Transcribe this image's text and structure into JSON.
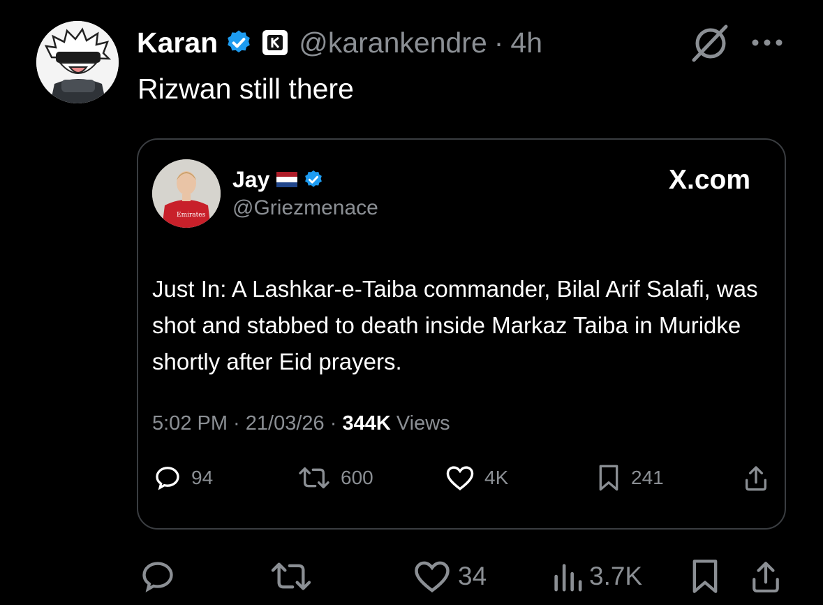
{
  "post": {
    "author_name": "Karan",
    "handle": "@karankendre",
    "separator": "·",
    "time": "4h",
    "text": "Rizwan still there"
  },
  "quoted": {
    "author_name": "Jay",
    "handle": "@Griezmenace",
    "source": "X.com",
    "text": "Just In: A Lashkar-e-Taiba commander, Bilal Arif Salafi, was shot and stabbed to death inside Markaz Taiba in Muridke shortly after Eid prayers.",
    "time": "5:02 PM",
    "date": "21/03/26",
    "views_count": "344K",
    "views_label": "Views",
    "replies": "94",
    "reposts": "600",
    "likes": "4K",
    "bookmarks": "241"
  },
  "actions": {
    "replies": "",
    "reposts": "",
    "likes": "34",
    "views": "3.7K"
  },
  "colors": {
    "background": "#000000",
    "text": "#ffffff",
    "secondary": "#8b8f94",
    "verified": "#1d9bf0",
    "border": "#3a3d41"
  },
  "icons": [
    "verified-badge-icon",
    "affiliate-k-icon",
    "grok-icon",
    "more-icon",
    "reply-icon",
    "repost-icon",
    "like-icon",
    "bookmark-icon",
    "share-icon",
    "views-icon"
  ]
}
